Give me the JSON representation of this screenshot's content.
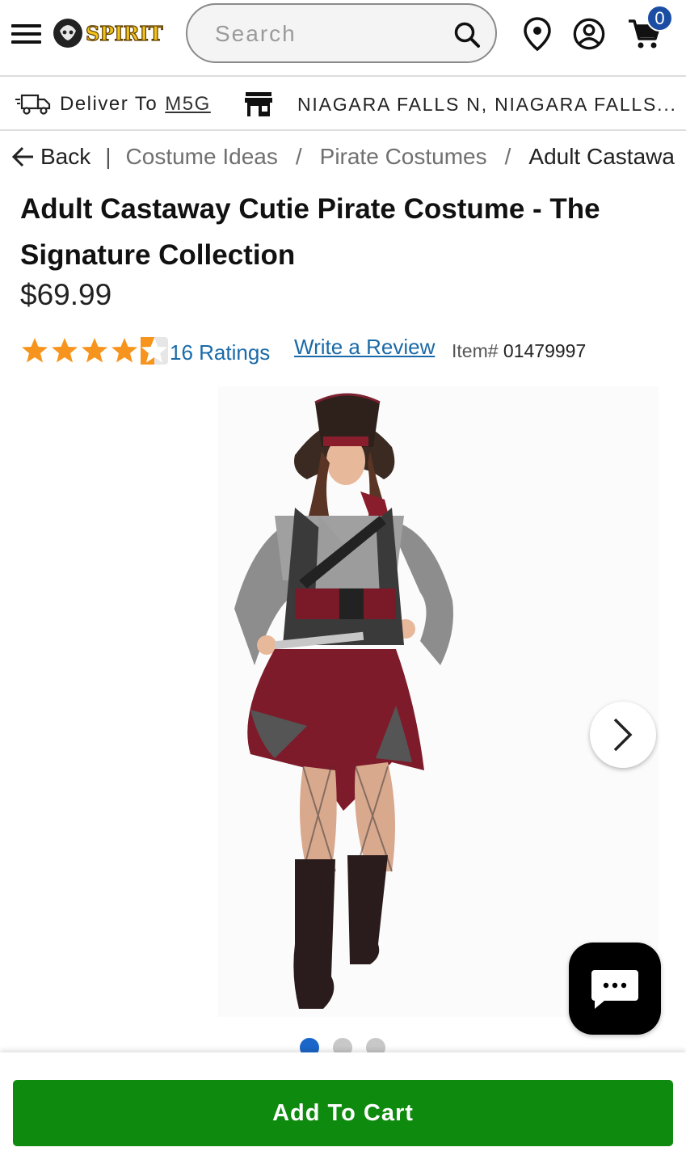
{
  "header": {
    "logo_text": "SPIRIT",
    "search_placeholder": "Search",
    "cart_count": "0"
  },
  "delivery": {
    "deliver_label": "Deliver To",
    "zip": "M5G",
    "store_name": "NIAGARA FALLS N, NIAGARA FALLS..."
  },
  "breadcrumb": {
    "back_label": "Back",
    "items": [
      "Costume Ideas",
      "Pirate Costumes",
      "Adult Castawa"
    ]
  },
  "product": {
    "title_line1": "Adult Castaway Cutie Pirate Costume - The",
    "title_line2": "Signature Collection",
    "price": "$69.99",
    "rating": 4.5,
    "ratings_count_label": "16 Ratings",
    "write_review_label": "Write a Review",
    "item_label": "Item#",
    "item_number": "01479997"
  },
  "gallery": {
    "image_count": 3,
    "active_index": 0
  },
  "cart_button_label": "Add To Cart",
  "colors": {
    "star": "#f7941d",
    "link": "#1a6aa8",
    "add_to_cart": "#0e8a0e",
    "active_dot": "#1b66c9",
    "badge": "#1b4ea3"
  }
}
